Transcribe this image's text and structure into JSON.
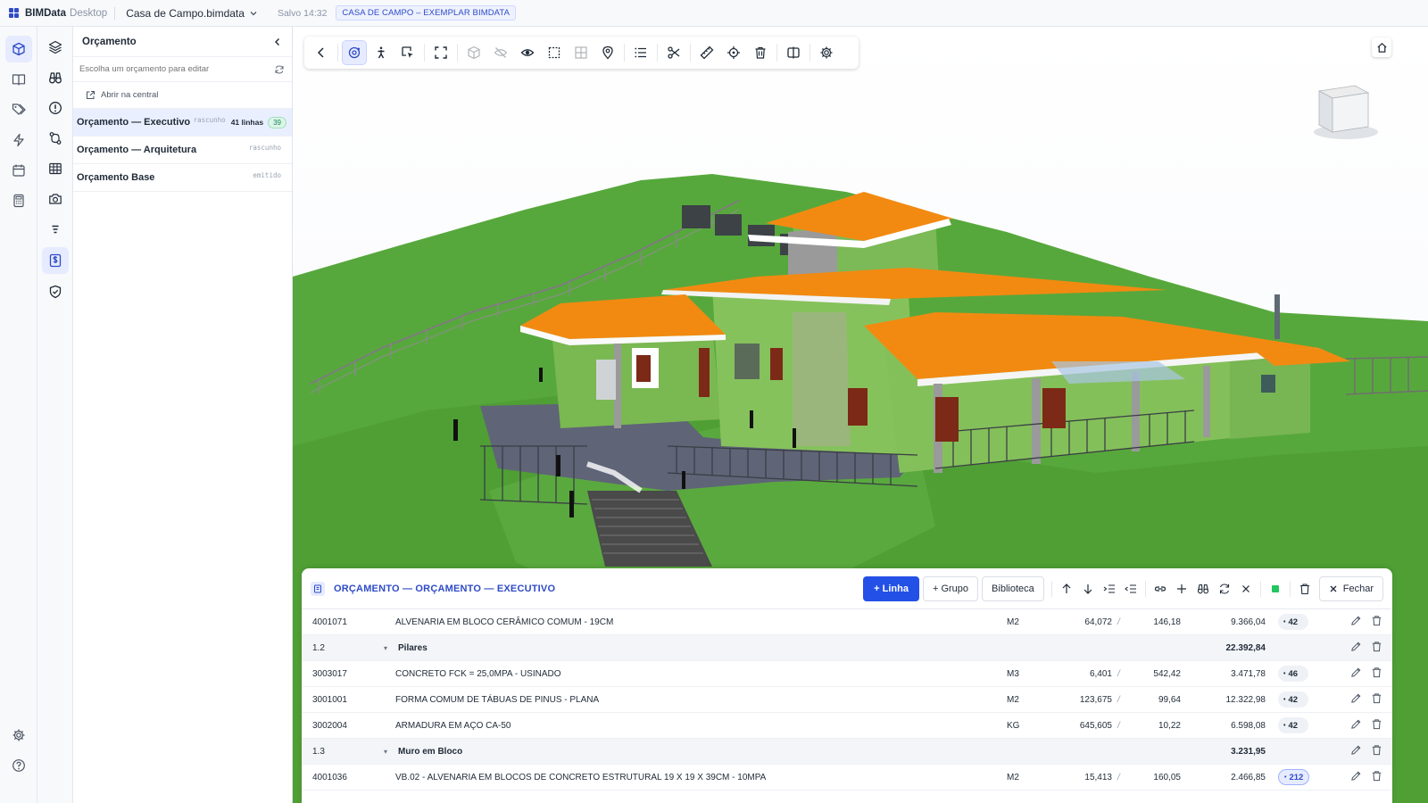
{
  "topbar": {
    "app_name": "BIMData",
    "app_sub": "Desktop",
    "file_name": "Casa de Campo.bimdata",
    "saved": "Salvo 14:32",
    "project": "CASA DE CAMPO – EXEMPLAR BIMDATA"
  },
  "rail_icons": [
    "3d-view-icon",
    "book-icon",
    "tags-icon",
    "bolt-icon",
    "calendar-icon",
    "calculator-icon"
  ],
  "rail2_icons": [
    "layers-icon",
    "binoculars-icon",
    "alert-icon",
    "git-compare-icon",
    "table-icon",
    "camera-icon",
    "list-icon",
    "budget-icon",
    "shield-check-icon"
  ],
  "rail_bottom_icons": [
    "settings-icon",
    "help-icon"
  ],
  "panel": {
    "title": "Orçamento",
    "search_placeholder": "Escolha um orçamento para editar",
    "open_central": "Abrir na central",
    "budgets": [
      {
        "name": "Orçamento — Executivo",
        "status": "rascunho",
        "lines": "41 linhas",
        "count": "39"
      },
      {
        "name": "Orçamento — Arquitetura",
        "status": "rascunho"
      },
      {
        "name": "Orçamento Base",
        "status": "emitido"
      }
    ]
  },
  "toolbar_icons": [
    "back-icon",
    "orbit-icon",
    "walk-icon",
    "select-icon",
    "fit-view-icon",
    "cube-icon",
    "hide-icon",
    "eye-icon",
    "box-select-icon",
    "grid-icon",
    "pin-icon",
    "list-icon",
    "scissors-icon",
    "ruler-icon",
    "target-icon",
    "trash-icon",
    "split-icon",
    "settings-icon"
  ],
  "table": {
    "title": "ORÇAMENTO — ORÇAMENTO — EXECUTIVO",
    "btn_line": "+ Linha",
    "btn_group": "+ Grupo",
    "btn_library": "Biblioteca",
    "btn_close": "Fechar",
    "rows": [
      {
        "kind": "item",
        "code": "4001071",
        "desc": "ALVENARIA EM BLOCO CERÂMICO COMUM - 19CM",
        "unit": "M2",
        "qty": "64,072",
        "price": "146,18",
        "total": "9.366,04",
        "tag": "42"
      },
      {
        "kind": "group",
        "code": "1.2",
        "name": "Pilares",
        "total": "22.392,84"
      },
      {
        "kind": "item",
        "code": "3003017",
        "desc": "CONCRETO FCK = 25,0MPA - USINADO",
        "unit": "M3",
        "qty": "6,401",
        "price": "542,42",
        "total": "3.471,78",
        "tag": "46"
      },
      {
        "kind": "item",
        "code": "3001001",
        "desc": "FORMA COMUM DE TÁBUAS DE PINUS - PLANA",
        "unit": "M2",
        "qty": "123,675",
        "price": "99,64",
        "total": "12.322,98",
        "tag": "42"
      },
      {
        "kind": "item",
        "code": "3002004",
        "desc": "ARMADURA EM AÇO CA-50",
        "unit": "KG",
        "qty": "645,605",
        "price": "10,22",
        "total": "6.598,08",
        "tag": "42"
      },
      {
        "kind": "group",
        "code": "1.3",
        "name": "Muro em Bloco",
        "total": "3.231,95"
      },
      {
        "kind": "item",
        "code": "4001036",
        "desc": "VB.02 - ALVENARIA EM BLOCOS DE CONCRETO ESTRUTURAL 19 X 19 X 39CM - 10MPA",
        "unit": "M2",
        "qty": "15,413",
        "price": "160,05",
        "total": "2.466,85",
        "tag": "212",
        "highlight": true
      }
    ]
  }
}
